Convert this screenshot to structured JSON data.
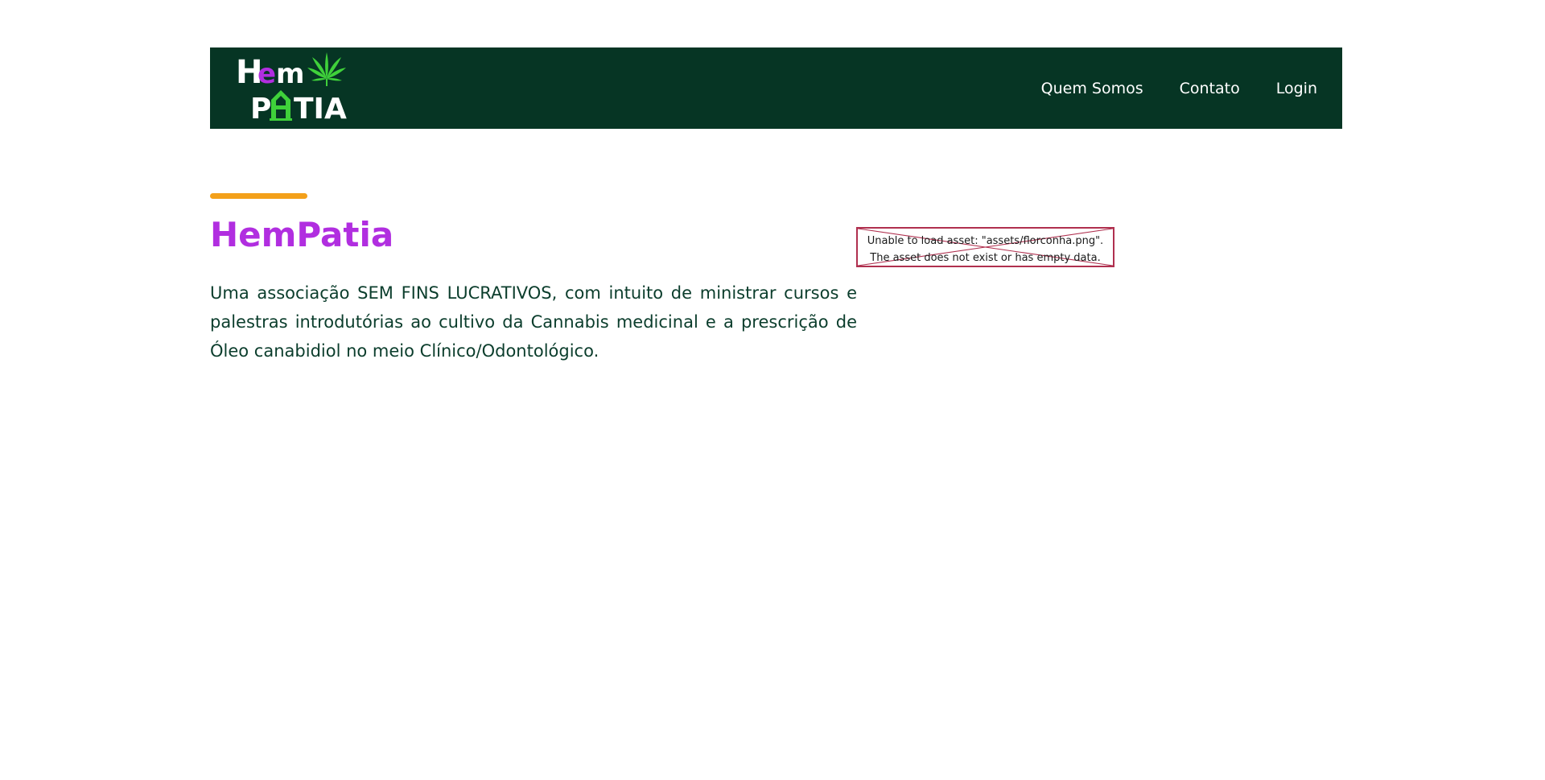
{
  "brand": {
    "logo_line1": "Hem",
    "logo_line2": "PATIA",
    "logo_icon": "cannabis-leaf-icon",
    "colors": {
      "navbar_bg": "#063524",
      "logo_white": "#ffffff",
      "logo_purple": "#b12ee0",
      "logo_green": "#3fd13a"
    }
  },
  "nav": {
    "items": [
      {
        "label": "Quem Somos"
      },
      {
        "label": "Contato"
      },
      {
        "label": "Login"
      }
    ]
  },
  "hero": {
    "accent_color": "#f3a01a",
    "title": "HemPatia",
    "title_color": "#b12ee0",
    "description": "Uma associação SEM FINS LUCRATIVOS, com intuito de ministrar cursos e palestras introdutórias ao cultivo da Cannabis medicinal e a prescrição de Óleo canabidiol no meio Clínico/Odontológico.",
    "text_color": "#0b3d2c"
  },
  "image_error": {
    "line1": "Unable to load asset: \"assets/florconha.png\".",
    "line2": "The asset does not exist or has empty data.",
    "border_color": "#b0304f"
  }
}
